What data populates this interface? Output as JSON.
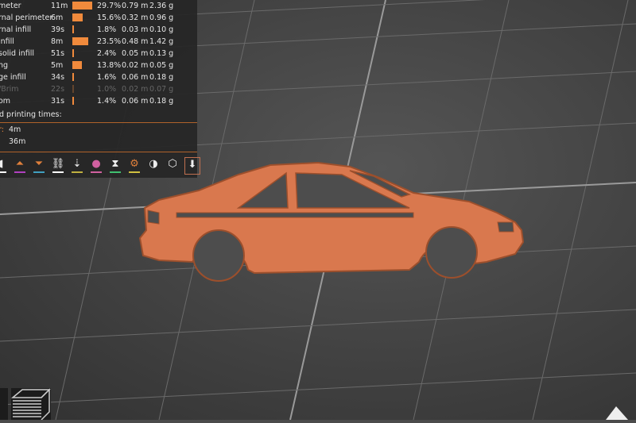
{
  "legend": {
    "rows": [
      {
        "label": "meter",
        "time": "11m",
        "percent": 29.7,
        "percent_label": "29.7%",
        "length": "0.79 m",
        "weight": "2.36 g"
      },
      {
        "label": "rnal perimeter",
        "time": "6m",
        "percent": 15.6,
        "percent_label": "15.6%",
        "length": "0.32 m",
        "weight": "0.96 g"
      },
      {
        "label": "rnal infill",
        "time": "39s",
        "percent": 1.8,
        "percent_label": "1.8%",
        "length": "0.03 m",
        "weight": "0.10 g"
      },
      {
        "label": " infill",
        "time": "8m",
        "percent": 23.5,
        "percent_label": "23.5%",
        "length": "0.48 m",
        "weight": "1.42 g"
      },
      {
        "label": "solid infill",
        "time": "51s",
        "percent": 2.4,
        "percent_label": "2.4%",
        "length": "0.05 m",
        "weight": "0.13 g"
      },
      {
        "label": "ng",
        "time": "5m",
        "percent": 13.8,
        "percent_label": "13.8%",
        "length": "0.02 m",
        "weight": "0.05 g"
      },
      {
        "label": "ge infill",
        "time": "34s",
        "percent": 1.6,
        "percent_label": "1.6%",
        "length": "0.06 m",
        "weight": "0.18 g"
      },
      {
        "label": "/Brim",
        "time": "22s",
        "percent": 1.0,
        "percent_label": "1.0%",
        "length": "0.02 m",
        "weight": "0.07 g",
        "dim": true
      },
      {
        "label": "om",
        "time": "31s",
        "percent": 1.4,
        "percent_label": "1.4%",
        "length": "0.06 m",
        "weight": "0.18 g"
      }
    ],
    "estimated_heading": "d printing times:",
    "estimate_1_label": "r:",
    "estimate_1_value": "4m",
    "estimate_2_value": "36m"
  },
  "toolbar": [
    {
      "icon": "support-icon",
      "color": "#ffffff"
    },
    {
      "icon": "layers-up-icon",
      "color": "#b040c0"
    },
    {
      "icon": "layers-down-icon",
      "color": "#40a0c0"
    },
    {
      "icon": "seam-icon",
      "color": "#ffffff"
    },
    {
      "icon": "retract-icon",
      "color": "#c0b040"
    },
    {
      "icon": "color-icon",
      "color": "#d060a0"
    },
    {
      "icon": "pause-icon",
      "color": "#40c070"
    },
    {
      "icon": "custom-gcode-icon",
      "color": "#d0c040"
    },
    {
      "icon": "center-of-gravity-icon",
      "color": ""
    },
    {
      "icon": "shells-icon",
      "color": ""
    },
    {
      "icon": "tool-marker-icon",
      "color": ""
    }
  ],
  "colors": {
    "accent": "#f08a3c",
    "model": "#d9784e",
    "background": "#4b4b4b"
  }
}
